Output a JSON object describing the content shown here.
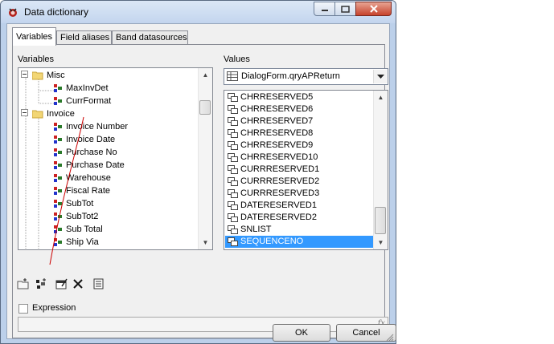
{
  "window": {
    "title": "Data dictionary"
  },
  "tabs": [
    {
      "label": "Variables",
      "active": true
    },
    {
      "label": "Field aliases",
      "active": false
    },
    {
      "label": "Band datasources",
      "active": false
    }
  ],
  "variables_panel": {
    "label": "Variables",
    "tree": [
      {
        "label": "Misc",
        "type": "folder",
        "level": 0,
        "expanded": true
      },
      {
        "label": "MaxInvDet",
        "type": "variable",
        "level": 1
      },
      {
        "label": "CurrFormat",
        "type": "variable",
        "level": 1
      },
      {
        "label": "Invoice",
        "type": "folder",
        "level": 0,
        "expanded": true
      },
      {
        "label": "Invoice Number",
        "type": "variable",
        "level": 1
      },
      {
        "label": "Invoice Date",
        "type": "variable",
        "level": 1
      },
      {
        "label": "Purchase No",
        "type": "variable",
        "level": 1
      },
      {
        "label": "Purchase Date",
        "type": "variable",
        "level": 1
      },
      {
        "label": "Warehouse",
        "type": "variable",
        "level": 1
      },
      {
        "label": "Fiscal Rate",
        "type": "variable",
        "level": 1
      },
      {
        "label": "SubTot",
        "type": "variable",
        "level": 1
      },
      {
        "label": "SubTot2",
        "type": "variable",
        "level": 1
      },
      {
        "label": "Sub Total",
        "type": "variable",
        "level": 1
      },
      {
        "label": "Ship Via",
        "type": "variable",
        "level": 1
      }
    ]
  },
  "values_panel": {
    "label": "Values",
    "datasource": "DialogForm.qryAPReturn",
    "fields": [
      {
        "label": "CHRRESERVED5",
        "selected": false
      },
      {
        "label": "CHRRESERVED6",
        "selected": false
      },
      {
        "label": "CHRRESERVED7",
        "selected": false
      },
      {
        "label": "CHRRESERVED8",
        "selected": false
      },
      {
        "label": "CHRRESERVED9",
        "selected": false
      },
      {
        "label": "CHRRESERVED10",
        "selected": false
      },
      {
        "label": "CURRRESERVED1",
        "selected": false
      },
      {
        "label": "CURRRESERVED2",
        "selected": false
      },
      {
        "label": "CURRRESERVED3",
        "selected": false
      },
      {
        "label": "DATERESERVED1",
        "selected": false
      },
      {
        "label": "DATERESERVED2",
        "selected": false
      },
      {
        "label": "SNLIST",
        "selected": false
      },
      {
        "label": "SEQUENCENO",
        "selected": true
      }
    ]
  },
  "toolbar": {
    "icons": [
      "new-category-icon",
      "new-variable-icon",
      "edit-icon",
      "delete-icon",
      "edit-list-icon"
    ]
  },
  "expression": {
    "label": "Expression",
    "checked": false,
    "value": ""
  },
  "buttons": {
    "ok": "OK",
    "cancel": "Cancel"
  },
  "colors": {
    "selection": "#3399ff",
    "annotation_line": "#cc0000"
  }
}
